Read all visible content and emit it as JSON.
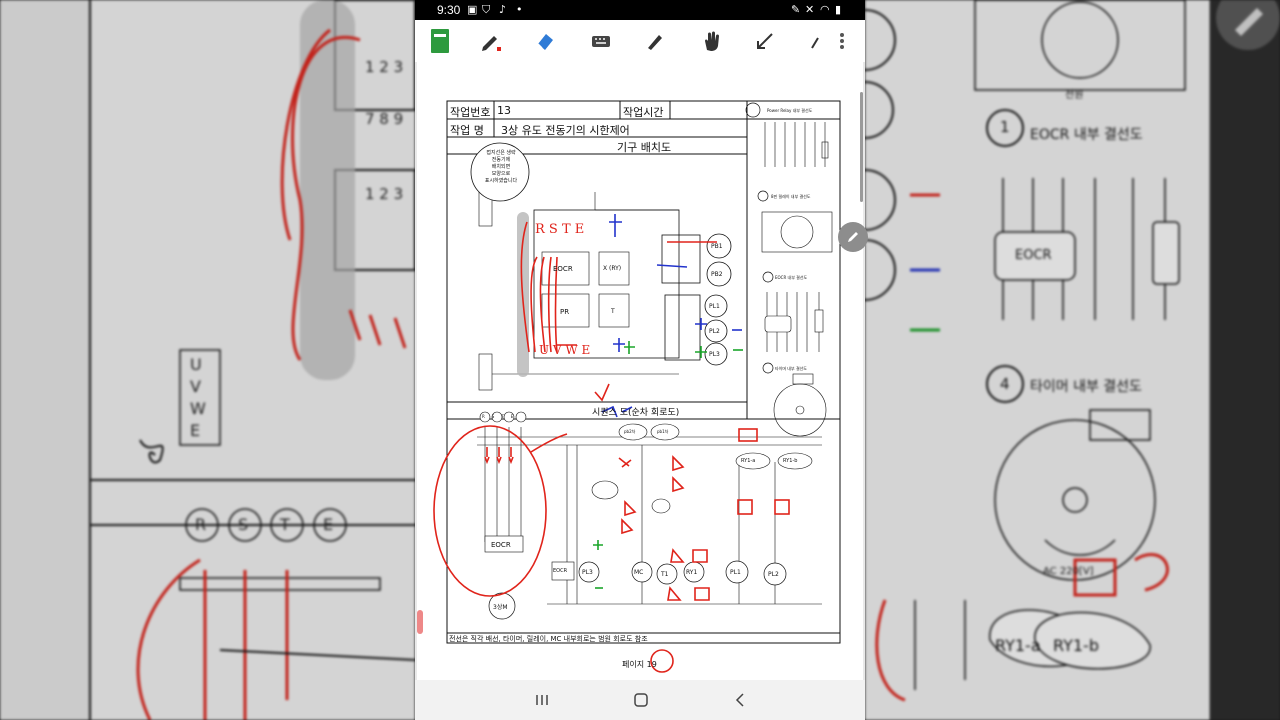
{
  "status_bar": {
    "time": "9:30",
    "left_icons": [
      "screenshot-icon",
      "shield-icon",
      "tiktok-icon",
      "dot-icon"
    ],
    "right_icons": [
      "pen-icon",
      "mute-icon",
      "wifi-icon",
      "battery-icon"
    ]
  },
  "toolbar": {
    "tools": [
      "notebook-icon",
      "pen-icon",
      "eraser-icon",
      "keyboard-icon",
      "highlighter-icon",
      "hand-icon",
      "arrow-icon",
      "pencil-icon",
      "more-icon"
    ]
  },
  "document": {
    "header": {
      "job_number_label": "작업번호",
      "job_number_value": "13",
      "work_time_label": "작업시간",
      "job_name_label": "작업 명",
      "job_name_value": "3상 유도 전동기의 시한제어",
      "layout_title": "기구 배치도"
    },
    "device_labels": {
      "eocr": "EOCR",
      "pr": "PR",
      "x_ry": "X (RY)",
      "t": "T",
      "pb1": "PB1",
      "pb2": "PB2",
      "pl1": "PL1",
      "pl2": "PL2",
      "pl3": "PL3",
      "rste": "R S T E",
      "uvwe": "U V W E"
    },
    "note_bubble": [
      "접지선은 생략",
      "전동기에",
      "배치되면",
      "모양으로",
      "표시하였습니다"
    ],
    "reference": {
      "power_relay": "Power Relay 내부 결선도",
      "eight_pin": "8핀 릴레이 내부 결선도",
      "eocr_internal": "EOCR 내부 결선도",
      "timer_internal": "타이머 내부 결선도"
    },
    "sequence_title": "시퀀스 도(순차 회로도)",
    "sequence_labels": {
      "rste": [
        "R",
        "S",
        "T",
        "E"
      ],
      "eocr": "EOCR",
      "motor": "3상M",
      "mc": "MC",
      "t1": "T1",
      "ry1": "RY1",
      "pl1": "PL1",
      "pl2": "PL2",
      "pl3": "PL3",
      "ry1_a": "RY1-a",
      "ry1_b": "RY1-b",
      "pb2": "pb2차",
      "pb1": "pb1차"
    },
    "footer_note": "전선은 직각 배선, 타이머, 릴레이, MC 내부회로는 범원 회로도 참조",
    "page_label": "페이지 19"
  },
  "background_left": {
    "labels": [
      "U",
      "V",
      "W",
      "E",
      "R",
      "S",
      "T",
      "E",
      "EOCR",
      "1 2 3",
      "7 8 9"
    ]
  },
  "background_right": {
    "labels": [
      "EOCR 내부 결선도",
      "타이머 내부 결선도",
      "EOCR",
      "RY1-a",
      "RY1-b",
      "AC 220[V]",
      "전원"
    ],
    "section_numbers": [
      "1",
      "4"
    ]
  },
  "nav_bar": {
    "buttons": [
      "recent-apps-icon",
      "home-icon",
      "back-icon"
    ]
  },
  "colors": {
    "annotation_red": "#e0241b",
    "annotation_blue": "#2233cc",
    "annotation_green": "#1aa52a",
    "accent_blue": "#2f7bd6",
    "notebook_green": "#2e9a3e"
  }
}
